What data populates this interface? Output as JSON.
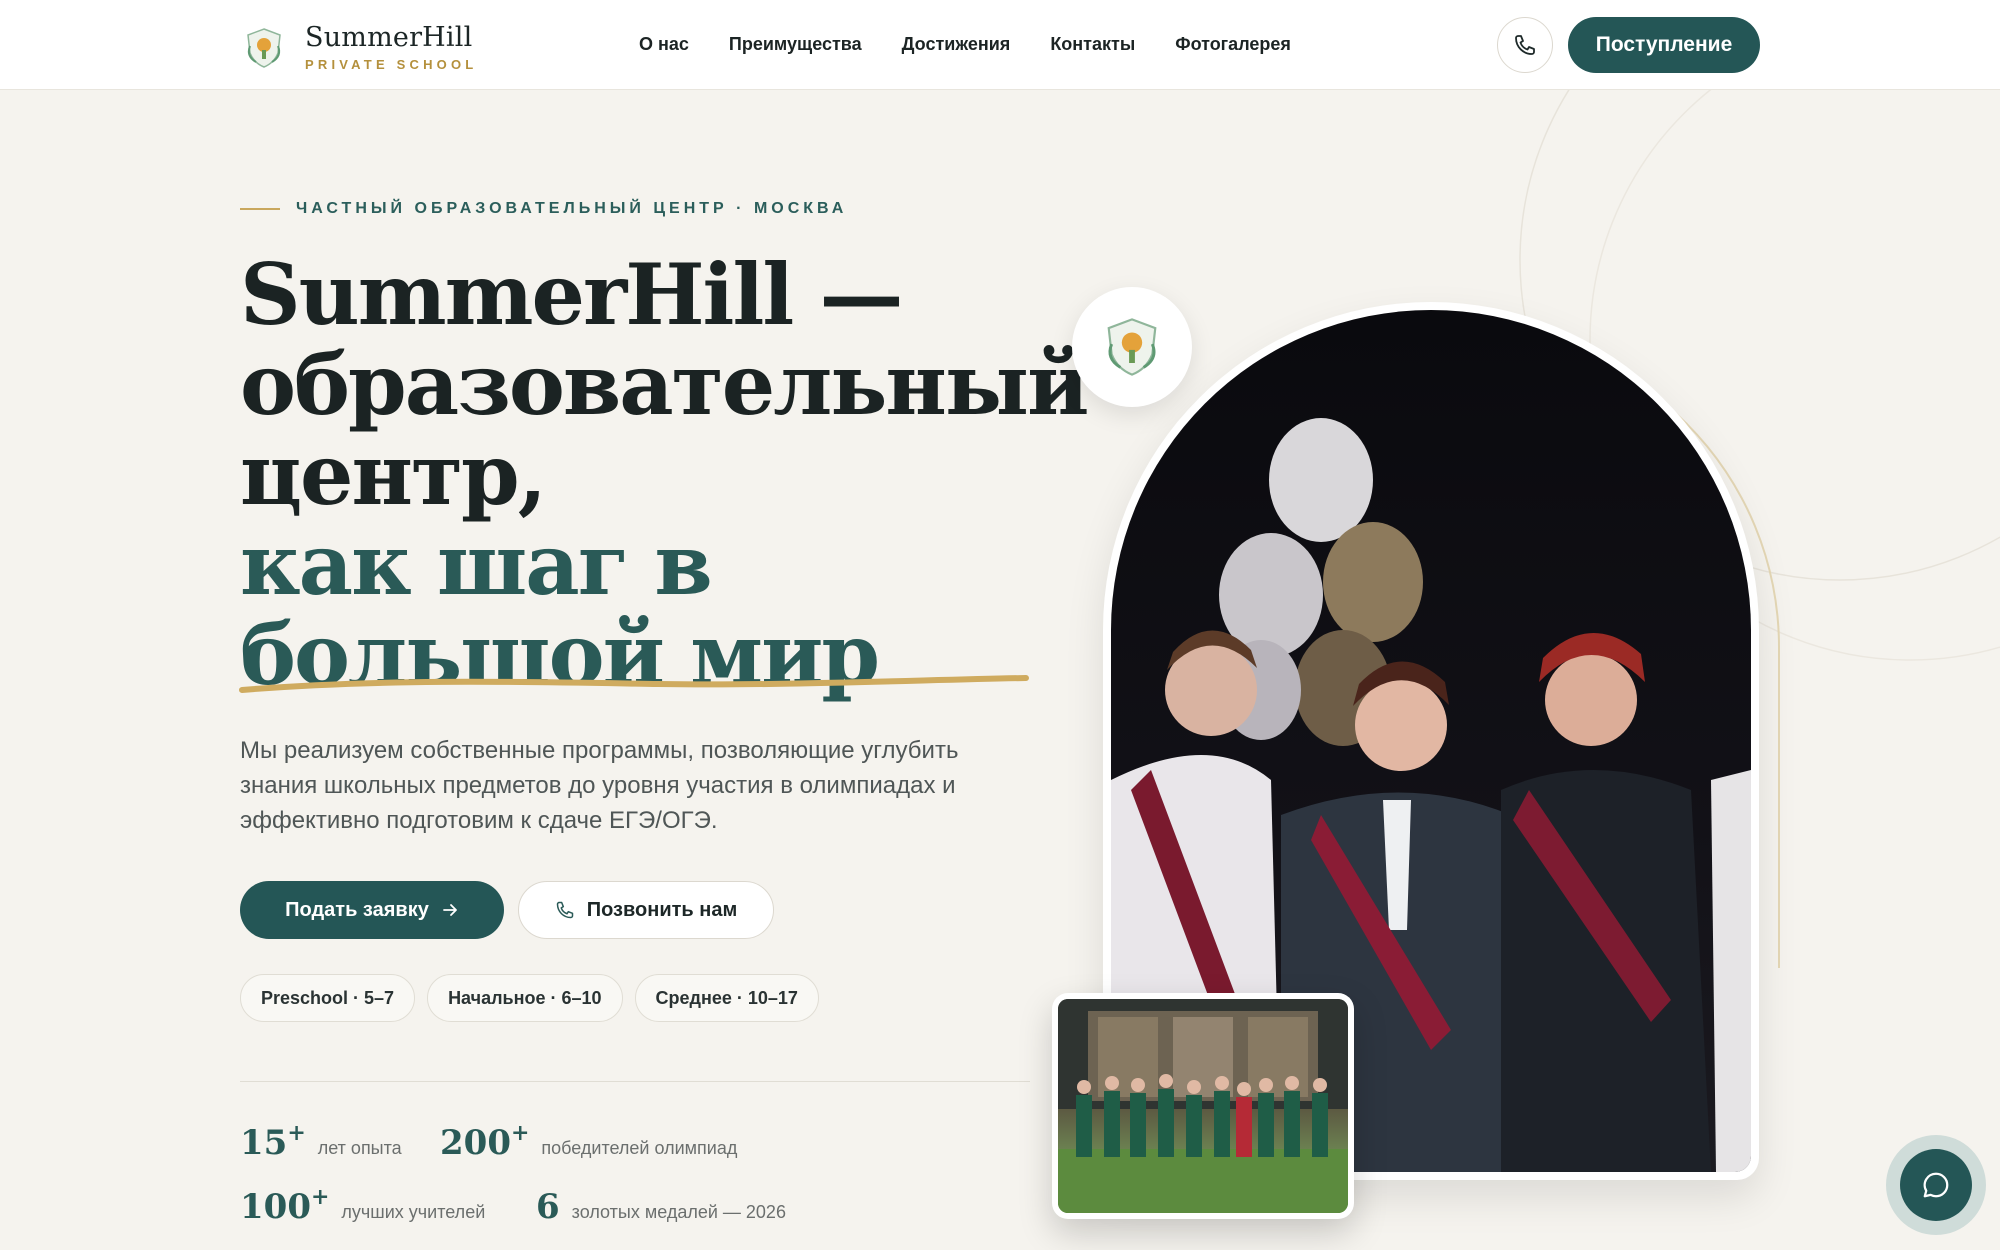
{
  "brand": {
    "name": "SummerHill",
    "subtitle": "PRIVATE SCHOOL"
  },
  "nav": {
    "items": [
      "О нас",
      "Преимущества",
      "Достижения",
      "Контакты",
      "Фотогалерея"
    ]
  },
  "header": {
    "phone_icon": "phone-icon",
    "cta_label": "Поступление"
  },
  "hero": {
    "eyebrow": "ЧАСТНЫЙ ОБРАЗОВАТЕЛЬНЫЙ ЦЕНТР · МОСКВА",
    "headline_lines_dark": [
      "SummerHill —",
      "образовательный",
      "центр,"
    ],
    "headline_lines_accent": [
      "как шаг в",
      "большой мир"
    ],
    "lead": "Мы реализуем собственные программы, позволяющие углубить знания школьных предметов до уровня участия в олимпиадах и эффективно подготовим к сдаче ЕГЭ/ОГЭ.",
    "primary_button": "Подать заявку",
    "secondary_button": "Позвонить нам",
    "chips": [
      "Preschool · 5–7",
      "Начальное · 6–10",
      "Среднее · 10–17"
    ]
  },
  "stats": [
    {
      "value": "15",
      "suffix": "+",
      "label": "лет опыта"
    },
    {
      "value": "200",
      "suffix": "+",
      "label": "победителей олимпиад"
    },
    {
      "value": "100",
      "suffix": "+",
      "label": "лучших учителей"
    },
    {
      "value": "6",
      "suffix": "",
      "label": "золотых медалей — 2026"
    }
  ],
  "colors": {
    "accent": "#245656",
    "gold": "#c9a75d",
    "background": "#f5f3ee"
  },
  "icons": {
    "chat": "chat-bubble-icon",
    "arrow": "arrow-right-icon"
  }
}
